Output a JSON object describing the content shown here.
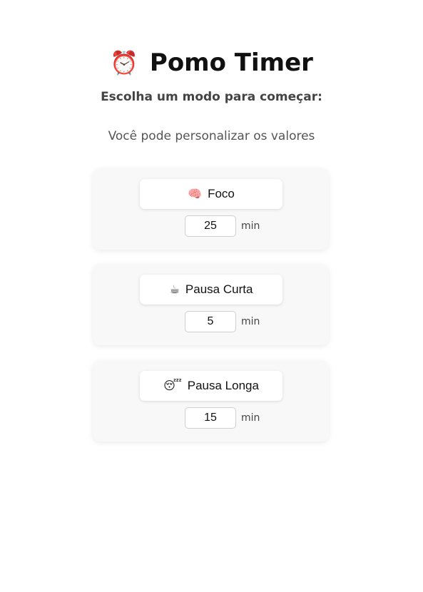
{
  "header": {
    "icon": "⏰",
    "icon_name": "alarm-clock-icon",
    "title": "Pomo Timer"
  },
  "subtitle": "Escolha um modo para começar:",
  "hint": "Você pode personalizar os valores",
  "modes": [
    {
      "icon": "🧠",
      "icon_name": "brain-icon",
      "label": "Foco",
      "minutes": "25",
      "unit": "min"
    },
    {
      "icon": "☕",
      "icon_name": "coffee-icon",
      "label": "Pausa Curta",
      "minutes": "5",
      "unit": "min"
    },
    {
      "icon": "😴",
      "icon_name": "sleeping-face-icon",
      "label": "Pausa Longa",
      "minutes": "15",
      "unit": "min"
    }
  ],
  "colors": {
    "background": "#ffffff",
    "card": "#f8f8f8",
    "button": "#ffffff",
    "text": "#111111"
  }
}
